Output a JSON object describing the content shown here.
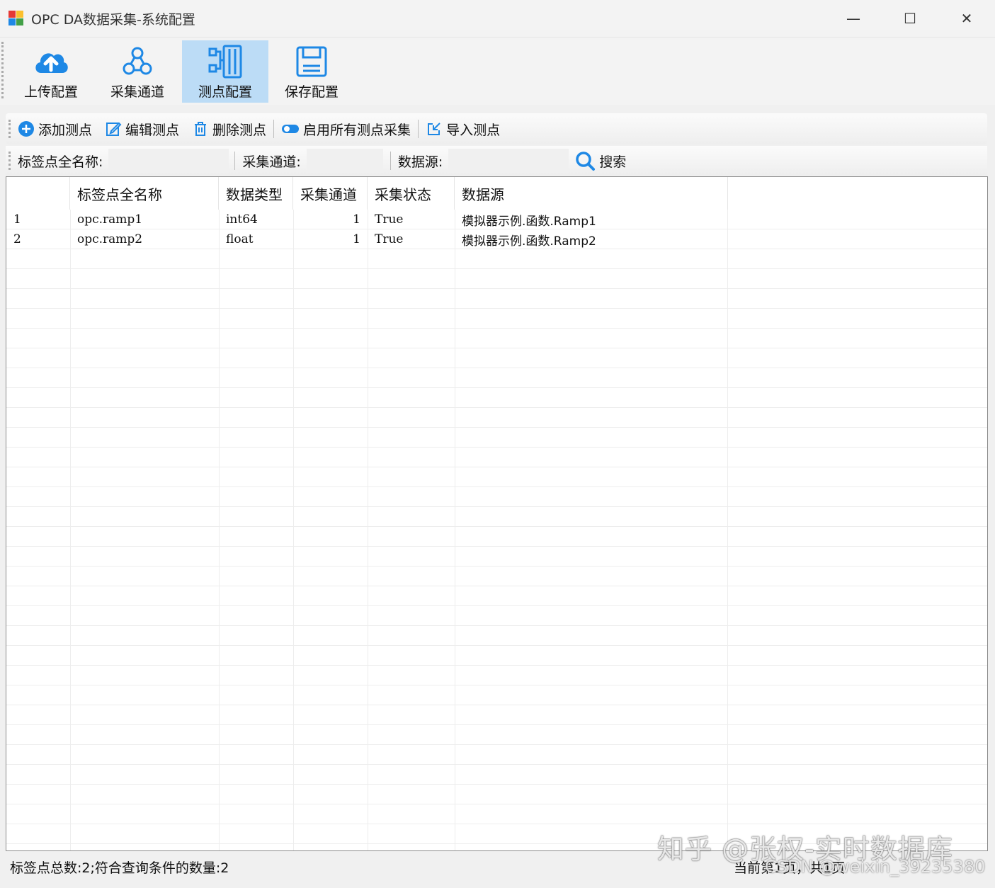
{
  "window": {
    "title": "OPC DA数据采集-系统配置",
    "minimize": "—",
    "maximize": "☐",
    "close": "✕"
  },
  "ribbon": {
    "items": [
      {
        "label": "上传配置",
        "icon": "upload-cloud-icon",
        "active": false
      },
      {
        "label": "采集通道",
        "icon": "channel-network-icon",
        "active": false
      },
      {
        "label": "测点配置",
        "icon": "point-config-icon",
        "active": true
      },
      {
        "label": "保存配置",
        "icon": "save-floppy-icon",
        "active": false
      }
    ]
  },
  "toolbar": {
    "add": "添加测点",
    "edit": "编辑测点",
    "delete": "删除测点",
    "enable_all": "启用所有测点采集",
    "import": "导入测点"
  },
  "search": {
    "tag_label": "标签点全名称:",
    "tag_value": "",
    "channel_label": "采集通道:",
    "channel_value": "",
    "source_label": "数据源:",
    "source_value": "",
    "button": "搜索"
  },
  "grid": {
    "columns": [
      "",
      "标签点全名称",
      "数据类型",
      "采集通道",
      "采集状态",
      "数据源"
    ],
    "rows": [
      [
        "1",
        "opc.ramp1",
        "int64",
        "1",
        "True",
        "模拟器示例.函数.Ramp1"
      ],
      [
        "2",
        "opc.ramp2",
        "float",
        "1",
        "True",
        "模拟器示例.函数.Ramp2"
      ]
    ]
  },
  "status": {
    "left": "标签点总数:2;符合查询条件的数量:2",
    "right": "当前第1页，共1页"
  },
  "watermark": {
    "main": "知乎 @张权-实时数据库",
    "sub": "CSDN @weixin_39235380"
  },
  "colors": {
    "accent": "#1e88e5",
    "active_bg": "#bcdcf6"
  }
}
